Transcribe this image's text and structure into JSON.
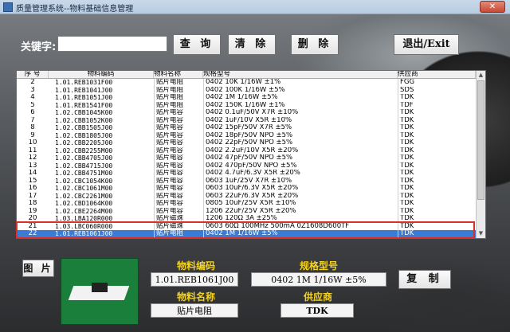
{
  "window": {
    "title": "质量管理系统--物料基础信息管理",
    "close_label": "✕"
  },
  "toolbar": {
    "keyword_label": "关键字:",
    "keyword_value": "",
    "query_label": "查 询",
    "clear_label": "清 除",
    "delete_label": "删 除",
    "exit_label": "退出/Exit"
  },
  "table": {
    "headers": {
      "no": "序 号",
      "code": "物料编码",
      "name": "物料名称",
      "spec": "规格型号",
      "supplier": "供应商"
    },
    "rows": [
      {
        "no": "2",
        "code": "1.01.REB1031F00",
        "name": "贴片电阻",
        "spec": "0402 10K 1/16W ±1%",
        "supplier": "FGG"
      },
      {
        "no": "3",
        "code": "1.01.REB1041J00",
        "name": "贴片电阻",
        "spec": "0402 100K 1/16W ±5%",
        "supplier": "SDS"
      },
      {
        "no": "4",
        "code": "1.01.REB1051J00",
        "name": "贴片电阻",
        "spec": "0402 1M 1/16W ±5%",
        "supplier": "TDK"
      },
      {
        "no": "5",
        "code": "1.01.REB1541F00",
        "name": "贴片电阻",
        "spec": "0402 150K 1/16W ±1%",
        "supplier": "TDF"
      },
      {
        "no": "6",
        "code": "1.02.CBB1045K00",
        "name": "贴片电容",
        "spec": "0402 0.1uF/50V X7R ±10%",
        "supplier": "TDK"
      },
      {
        "no": "7",
        "code": "1.02.CBB1052K00",
        "name": "贴片电容",
        "spec": "0402 1uF/10V X5R ±10%",
        "supplier": "TDK"
      },
      {
        "no": "8",
        "code": "1.02.CBB1505J00",
        "name": "贴片电容",
        "spec": "0402 15pF/50V X7R ±5%",
        "supplier": "TDK"
      },
      {
        "no": "9",
        "code": "1.02.CBB1805J00",
        "name": "贴片电容",
        "spec": "0402 18pF/50V NPO ±5%",
        "supplier": "TDK"
      },
      {
        "no": "10",
        "code": "1.02.CBB2205J00",
        "name": "贴片电容",
        "spec": "0402 22pF/50V NPO ±5%",
        "supplier": "TDK"
      },
      {
        "no": "11",
        "code": "1.02.CBB2255M00",
        "name": "贴片电容",
        "spec": "0402 2.2uF/10V X5R ±20%",
        "supplier": "TDK"
      },
      {
        "no": "12",
        "code": "1.02.CBB4705J00",
        "name": "贴片电容",
        "spec": "0402 47pF/50V NPO ±5%",
        "supplier": "TDK"
      },
      {
        "no": "13",
        "code": "1.02.CBB4715J00",
        "name": "贴片电容",
        "spec": "0402 470pF/50V NPO ±5%",
        "supplier": "TDK"
      },
      {
        "no": "14",
        "code": "1.02.CBB4751M00",
        "name": "贴片电容",
        "spec": "0402 4.7uF/6.3V X5R ±20%",
        "supplier": "TDK"
      },
      {
        "no": "15",
        "code": "1.02.CBC1054K00",
        "name": "贴片电容",
        "spec": "0603 1uF/25V X7R ±10%",
        "supplier": "TDK"
      },
      {
        "no": "16",
        "code": "1.02.CBC1061M00",
        "name": "贴片电容",
        "spec": "0603 10uF/6.3V X5R ±20%",
        "supplier": "TDK"
      },
      {
        "no": "17",
        "code": "1.02.CBC2261M00",
        "name": "贴片电容",
        "spec": "0603 22uF/6.3V X5R ±20%",
        "supplier": "TDK"
      },
      {
        "no": "18",
        "code": "1.02.CBD1064K00",
        "name": "贴片电容",
        "spec": "0805 10uF/25V X5R ±10%",
        "supplier": "TDK"
      },
      {
        "no": "19",
        "code": "1.02.CBE2264M00",
        "name": "贴片电容",
        "spec": "1206 22uF/25V X5R ±20%",
        "supplier": "TDK"
      },
      {
        "no": "20",
        "code": "1.03.LBA120R000",
        "name": "贴片磁珠",
        "spec": "1206 120Ω 3A ±25%",
        "supplier": "TDK"
      },
      {
        "no": "21",
        "code": "1.03.LBC060R000",
        "name": "贴片磁珠",
        "spec": "0603 60Ω 100MHz 500mA 0Z1608D600TF",
        "supplier": "TDK"
      },
      {
        "no": "22",
        "code": "1.01.REB1061J00",
        "name": "贴片电阻",
        "spec": "0402 1M 1/16W ±5%",
        "supplier": "TDK"
      }
    ]
  },
  "detail": {
    "picture_label": "图 片",
    "code_label": "物料编码",
    "code_value": "1.01.REB1061J00",
    "spec_label": "规格型号",
    "spec_value": "0402 1M 1/16W ±5%",
    "name_label": "物料名称",
    "name_value": "贴片电阻",
    "supplier_label": "供应商",
    "supplier_value": "TDK",
    "copy_label": "复 制"
  },
  "colors": {
    "selection": "#3a7bd5",
    "highlight_box": "#d9302a",
    "field_label": "#f5d21c"
  }
}
